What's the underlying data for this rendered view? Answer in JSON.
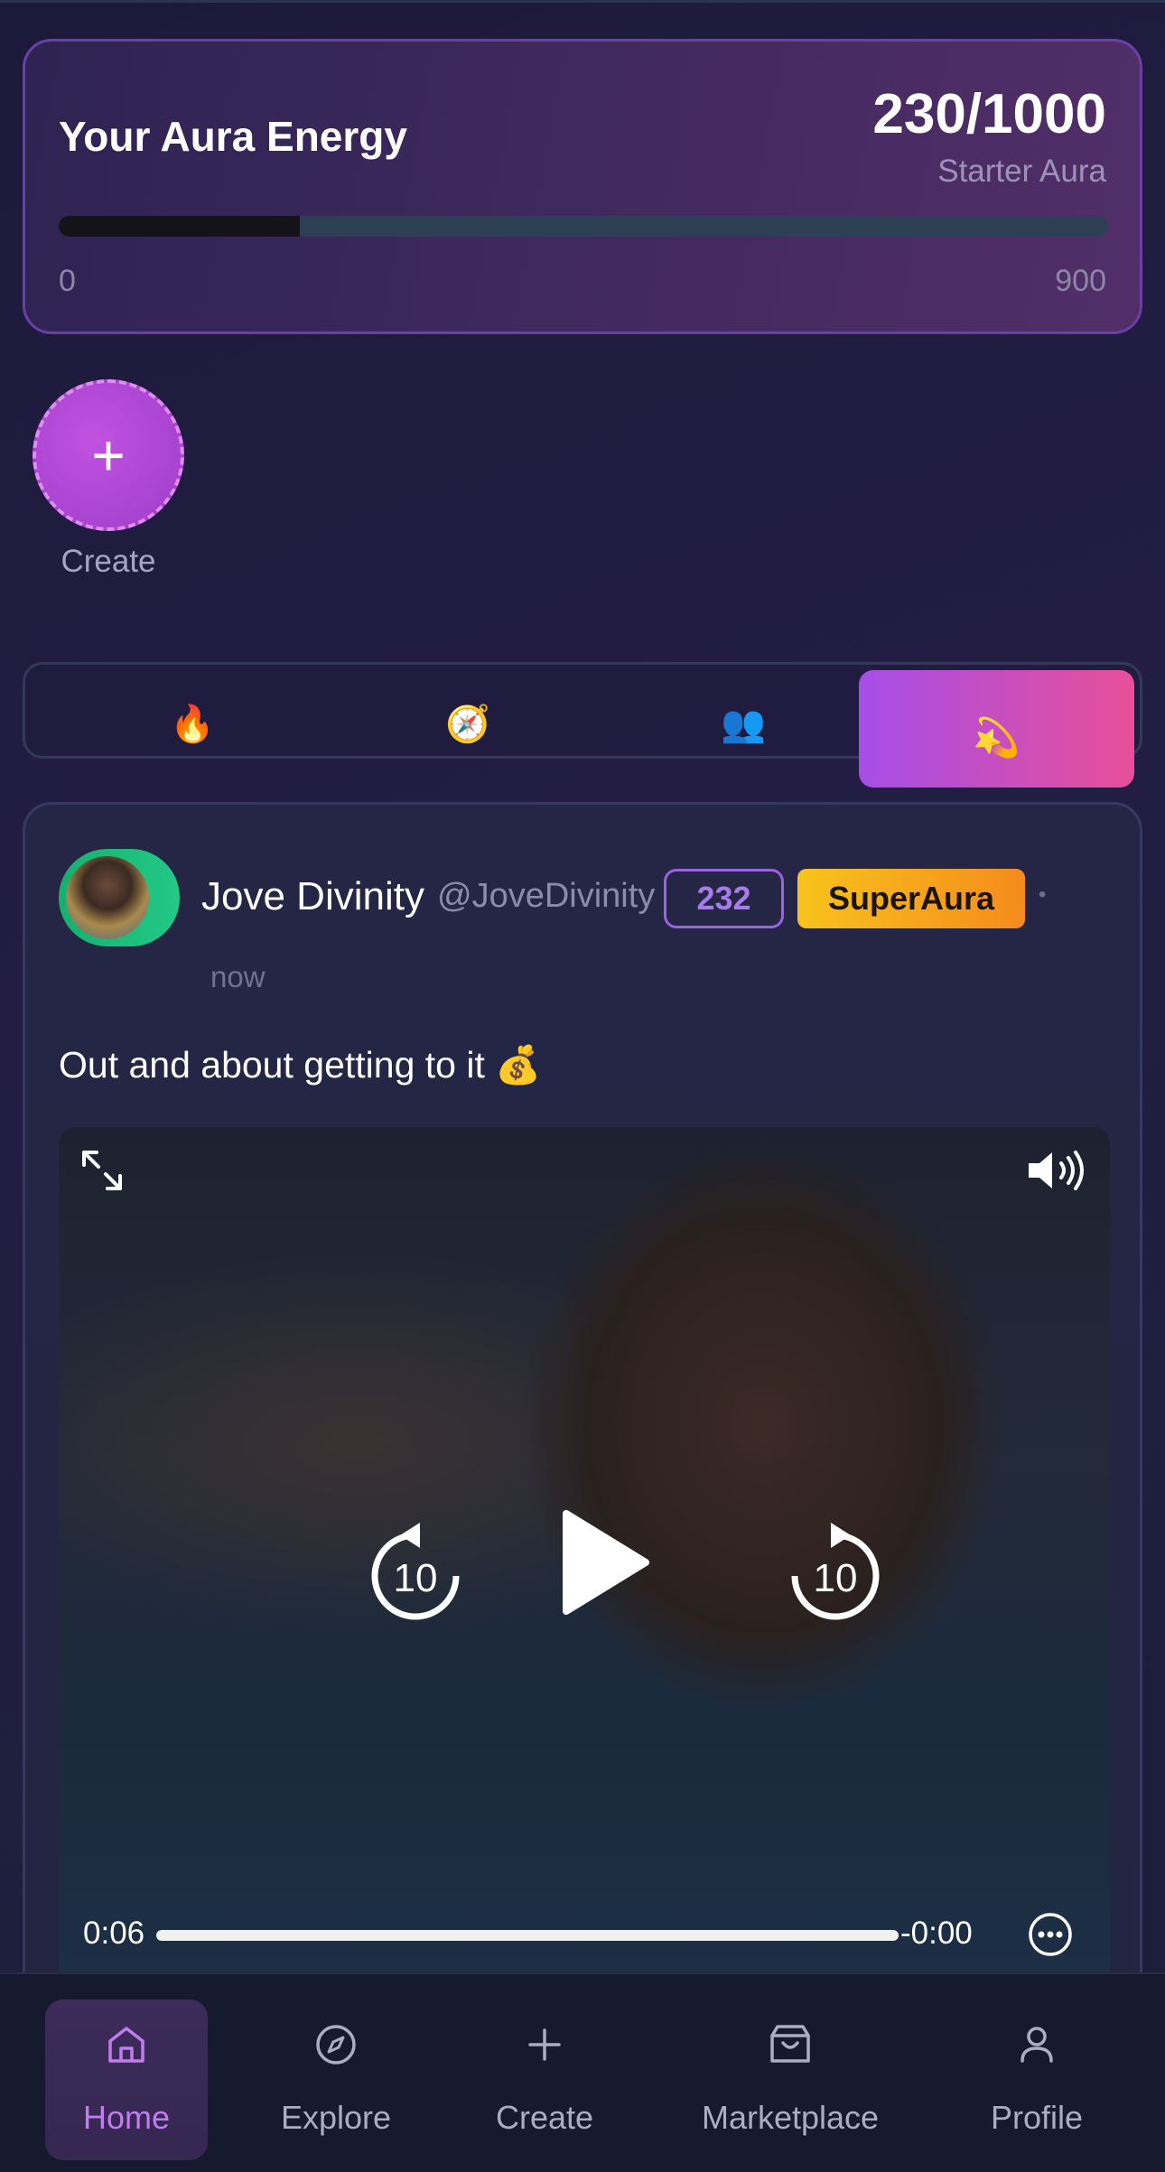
{
  "aura": {
    "title": "Your Aura Energy",
    "score": "230/1000",
    "level": "Starter Aura",
    "progress_fraction": 0.23,
    "min_label": "0",
    "max_label": "900"
  },
  "create_story": {
    "label": "Create",
    "icon": "plus-icon"
  },
  "feed_tabs": [
    {
      "icon": "fire-emoji",
      "glyph": "🔥"
    },
    {
      "icon": "compass-emoji",
      "glyph": "🧭"
    },
    {
      "icon": "people-emoji",
      "glyph": "👥"
    },
    {
      "icon": "dizzy-star-emoji",
      "glyph": "💫",
      "active": true
    }
  ],
  "post": {
    "author_name": "Jove Divinity",
    "author_handle": "@JoveDivinity",
    "aura_score": "232",
    "badge": "SuperAura",
    "separator": "•",
    "time": "now",
    "text": "Out and about getting to it 💰",
    "video": {
      "elapsed": "0:06",
      "remaining": "-0:00",
      "progress_fraction": 1.0,
      "skip_seconds": "10"
    }
  },
  "bottom_nav": {
    "items": [
      {
        "label": "Home",
        "icon": "home-icon",
        "active": true
      },
      {
        "label": "Explore",
        "icon": "compass-icon"
      },
      {
        "label": "Create",
        "icon": "plus-icon"
      },
      {
        "label": "Marketplace",
        "icon": "shopping-bag-icon"
      },
      {
        "label": "Profile",
        "icon": "user-icon"
      }
    ]
  },
  "colors": {
    "accent_purple": "#a64ee8",
    "accent_pink": "#e84f98",
    "badge_gold": "#f8c31c",
    "avatar_ring_green": "#16b06e",
    "nav_active": "#c27cf0"
  }
}
